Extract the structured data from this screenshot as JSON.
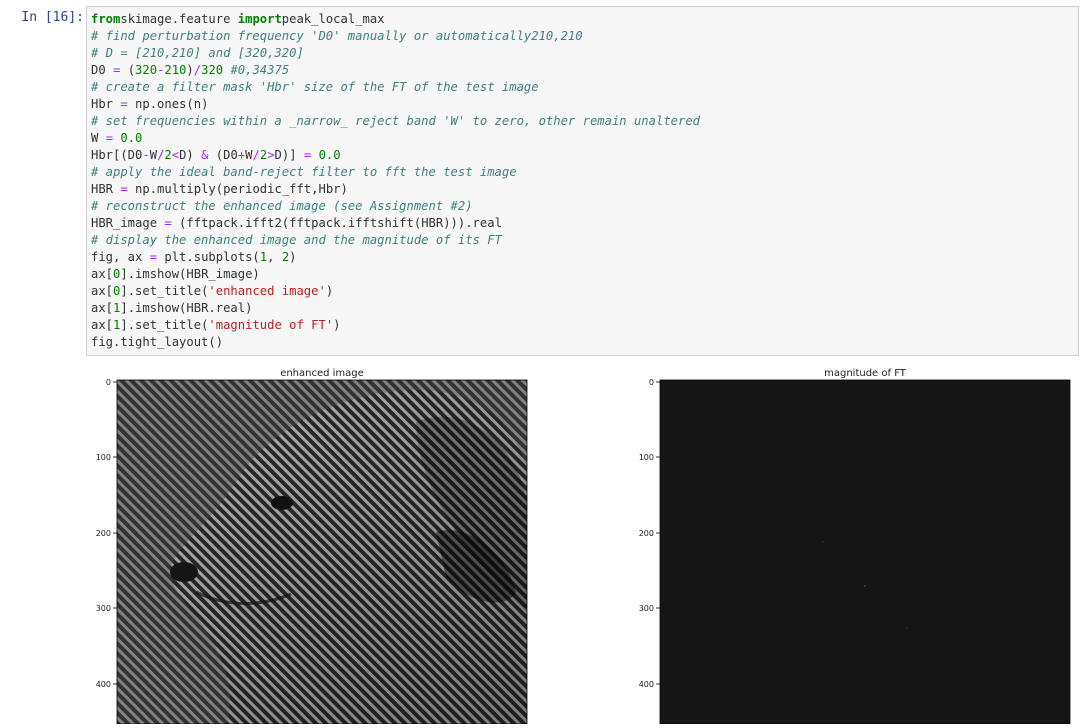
{
  "cell": {
    "prompt": "In [16]:",
    "code_lines": [
      [
        [
          "k",
          "from"
        ],
        [
          "",
          "skimage.feature "
        ],
        [
          "k",
          "import"
        ],
        [
          "",
          "peak_local_max"
        ]
      ],
      [
        [
          "c",
          "# find perturbation frequency 'D0' manually or automatically210,210"
        ]
      ],
      [
        [
          "c",
          "# D = [210,210] and [320,320]"
        ]
      ],
      [
        [
          "",
          "D0 "
        ],
        [
          "o",
          "="
        ],
        [
          "",
          " ("
        ],
        [
          "n",
          "320"
        ],
        [
          "o",
          "-"
        ],
        [
          "n",
          "210"
        ],
        [
          "",
          ")"
        ],
        [
          "o",
          "/"
        ],
        [
          "n",
          "320"
        ],
        [
          "c",
          " #0,34375"
        ]
      ],
      [
        [
          "c",
          "# create a filter mask 'Hbr' size of the FT of the test image"
        ]
      ],
      [
        [
          "",
          "Hbr "
        ],
        [
          "o",
          "="
        ],
        [
          "",
          " np.ones(n)"
        ]
      ],
      [
        [
          "c",
          "# set frequencies within a _narrow_ reject band 'W' to zero, other remain unaltered"
        ]
      ],
      [
        [
          "",
          "W "
        ],
        [
          "o",
          "="
        ],
        [
          "n",
          " 0.0"
        ]
      ],
      [
        [
          "",
          "Hbr[(D0"
        ],
        [
          "o",
          "-"
        ],
        [
          "",
          "W"
        ],
        [
          "o",
          "/"
        ],
        [
          "n",
          "2"
        ],
        [
          "o",
          "<"
        ],
        [
          "",
          "D) "
        ],
        [
          "o",
          "&"
        ],
        [
          "",
          " (D0"
        ],
        [
          "o",
          "+"
        ],
        [
          "",
          "W"
        ],
        [
          "o",
          "/"
        ],
        [
          "n",
          "2"
        ],
        [
          "o",
          ">"
        ],
        [
          "",
          "D)] "
        ],
        [
          "o",
          "="
        ],
        [
          "n",
          " 0.0"
        ]
      ],
      [
        [
          "c",
          "# apply the ideal band-reject filter to fft the test image"
        ]
      ],
      [
        [
          "",
          "HBR "
        ],
        [
          "o",
          "="
        ],
        [
          "",
          " np.multiply(periodic_fft,Hbr)"
        ]
      ],
      [
        [
          "c",
          "# reconstruct the enhanced image (see Assignment #2)"
        ]
      ],
      [
        [
          "",
          "HBR_image "
        ],
        [
          "o",
          "="
        ],
        [
          "",
          " (fftpack.ifft2(fftpack.ifftshift(HBR))).real"
        ]
      ],
      [
        [
          "c",
          "# display the enhanced image and the magnitude of its FT"
        ]
      ],
      [
        [
          "",
          "fig, ax "
        ],
        [
          "o",
          "="
        ],
        [
          "",
          " plt.subplots("
        ],
        [
          "n",
          "1"
        ],
        [
          "",
          ", "
        ],
        [
          "n",
          "2"
        ],
        [
          "",
          ")"
        ]
      ],
      [
        [
          "",
          "ax["
        ],
        [
          "n",
          "0"
        ],
        [
          "",
          "].imshow(HBR_image)"
        ]
      ],
      [
        [
          "",
          "ax["
        ],
        [
          "n",
          "0"
        ],
        [
          "",
          "].set_title("
        ],
        [
          "s",
          "'enhanced image'"
        ],
        [
          "",
          ")"
        ]
      ],
      [
        [
          "",
          "ax["
        ],
        [
          "n",
          "1"
        ],
        [
          "",
          "].imshow(HBR.real)"
        ]
      ],
      [
        [
          "",
          "ax["
        ],
        [
          "n",
          "1"
        ],
        [
          "",
          "].set_title("
        ],
        [
          "s",
          "'magnitude of FT'"
        ],
        [
          "",
          ")"
        ]
      ],
      [
        [
          "",
          "fig.tight_layout()"
        ]
      ]
    ]
  },
  "output": {
    "left_plot": {
      "title": "enhanced image",
      "y_ticks": [
        "0",
        "100",
        "200",
        "300",
        "400"
      ]
    },
    "right_plot": {
      "title": "magnitude of FT",
      "y_ticks": [
        "0",
        "100",
        "200",
        "300",
        "400"
      ]
    }
  },
  "colors": {
    "prompt": "#303f9f",
    "input_bg": "#f7f7f7",
    "input_border": "#cfcfcf",
    "ft_bg": "#151515"
  }
}
